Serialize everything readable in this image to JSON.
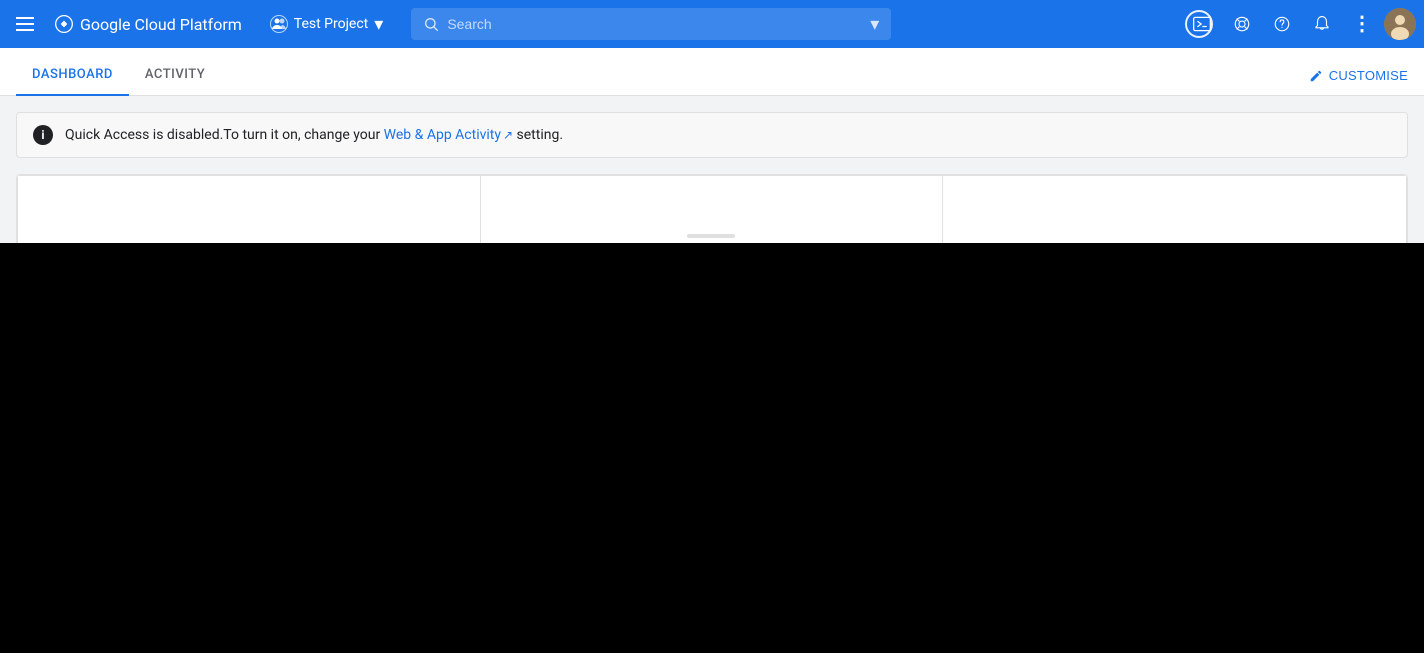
{
  "topbar": {
    "title": "Google Cloud Platform",
    "project": {
      "name": "Test Project",
      "icon": "●"
    },
    "search_placeholder": "Search",
    "icons": {
      "code": "⌨",
      "settings": "⚙",
      "help": "?",
      "notifications": "🔔",
      "more": "⋮"
    }
  },
  "tabs": {
    "items": [
      {
        "label": "DASHBOARD",
        "active": true
      },
      {
        "label": "ACTIVITY",
        "active": false
      }
    ],
    "customise_label": "CUSTOMISE"
  },
  "notification": {
    "message_before": "Quick Access is disabled.To turn it on, change your ",
    "link_text": "Web & App Activity",
    "message_after": " setting."
  },
  "toolbar": {
    "keyboard_icon": "⌨",
    "gear_icon": "⚙",
    "add_icon": "+",
    "monitor_icon": "□",
    "pencil_icon": "✎",
    "image_icon": "▣",
    "more_icon": "⋮",
    "minimize_icon": "—",
    "external_icon": "⤢",
    "close_icon": "✕"
  }
}
